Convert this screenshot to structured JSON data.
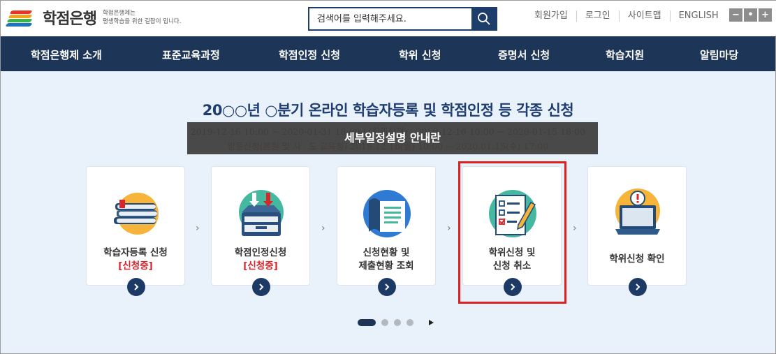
{
  "header": {
    "logo_name": "학점은행",
    "logo_sub_line1": "학점은행제는",
    "logo_sub_line2": "평생학습을 위한 길잡이 입니다.",
    "logo_colors": [
      "#e8332a",
      "#f4a21d",
      "#3bb54a",
      "#1e74bb"
    ],
    "search": {
      "placeholder": "검색어를 입력해주세요."
    },
    "util_links": [
      "회원가입",
      "로그인",
      "사이트맵",
      "ENGLISH"
    ],
    "zoom": [
      "−",
      "•",
      "+"
    ]
  },
  "nav": {
    "items": [
      "학점은행제 소개",
      "표준교육과정",
      "학점인정 신청",
      "학위 신청",
      "증명서 신청",
      "학습지원",
      "알림마당"
    ]
  },
  "main": {
    "headline": "20○○년 ○분기 온라인 학습자등록 및 학점인정 등 각종 신청",
    "dates_line1": "2019-12-16 10:00 ~ 2020-01-31 18:00 / (학위신청) : 2019-12-16 10:00 ~ 2020-01-15 18:00",
    "dates_line2": "방문신청(본원 및 시 · 도 교육청) 2019.12.16(월) 10:00 ~ 2020.01.15(수) 17:00",
    "tooltip": "세부일정설명 안내란",
    "cards": [
      {
        "line1": "학습자등록 신청",
        "line2": "[신청중]",
        "icon": "books-icon"
      },
      {
        "line1": "학점인정신청",
        "line2": "[신청중]",
        "icon": "inbox-tray-icon"
      },
      {
        "line1": "신청현황 및",
        "line2": "제출현황 조회",
        "icon": "document-scroll-icon"
      },
      {
        "line1": "학위신청 및",
        "line2": "신청 취소",
        "icon": "checklist-pencil-icon"
      },
      {
        "line1": "학위신청 확인",
        "line2": "",
        "icon": "laptop-alert-icon"
      }
    ],
    "highlight_color": "#e02020"
  }
}
